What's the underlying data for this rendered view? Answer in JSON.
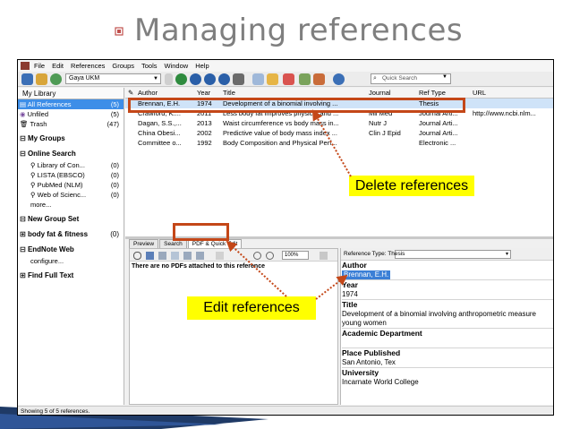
{
  "slide": {
    "title": "Managing references"
  },
  "menu": {
    "items": [
      "File",
      "Edit",
      "References",
      "Groups",
      "Tools",
      "Window",
      "Help"
    ]
  },
  "toolbar": {
    "library": "Gaya UKM",
    "quick_search": "Quick Search"
  },
  "sidebar": {
    "header": "My Library",
    "library_items": [
      {
        "label": "All References",
        "count": "(5)"
      },
      {
        "label": "Unfiled",
        "count": "(5)"
      },
      {
        "label": "Trash",
        "count": "(47)"
      }
    ],
    "my_groups": "My Groups",
    "online_search": "Online Search",
    "online_items": [
      {
        "label": "Library of Con...",
        "count": "(0)"
      },
      {
        "label": "LISTA (EBSCO)",
        "count": "(0)"
      },
      {
        "label": "PubMed (NLM)",
        "count": "(0)"
      },
      {
        "label": "Web of Scienc...",
        "count": "(0)"
      }
    ],
    "more": "more...",
    "new_group_set": "New Group Set",
    "group_set": {
      "label": "body fat & fitness",
      "count": "(0)"
    },
    "endnote_web": "EndNote Web",
    "configure": "configure...",
    "find_full_text": "Find Full Text"
  },
  "reflist": {
    "columns": {
      "author": "Author",
      "year": "Year",
      "title": "Title",
      "journal": "Journal",
      "ref_type": "Ref Type",
      "url": "URL"
    },
    "rows": [
      {
        "author": "Brennan, E.H.",
        "year": "1974",
        "title": "Development of a binomial involving ...",
        "journal": "",
        "ref_type": "Thesis",
        "url": ""
      },
      {
        "author": "Crawford, K....",
        "year": "2011",
        "title": "Less body fat improves physical and ...",
        "journal": "Mil Med",
        "ref_type": "Journal Arti...",
        "url": "http://www.ncbi.nlm..."
      },
      {
        "author": "Dagan, S.S.,...",
        "year": "2013",
        "title": "Waist circumference vs body mass in...",
        "journal": "Nutr J",
        "ref_type": "Journal Arti...",
        "url": ""
      },
      {
        "author": "China Obesi...",
        "year": "2002",
        "title": "Predictive value of body mass index ...",
        "journal": "Clin J Epid",
        "ref_type": "Journal Arti...",
        "url": ""
      },
      {
        "author": "Committee o...",
        "year": "1992",
        "title": "Body Composition and Physical Perf...",
        "journal": "",
        "ref_type": "Electronic ...",
        "url": ""
      }
    ]
  },
  "tabs": [
    "Preview",
    "Search",
    "PDF & Quick Edit"
  ],
  "pdf": {
    "zoom": "100%",
    "message": "There are no PDFs attached to this reference"
  },
  "ref_editor": {
    "ref_type_label": "Reference Type: Thesis",
    "author_label": "Author",
    "author_value": "Brennan, E.H.",
    "year_label": "Year",
    "year_value": "1974",
    "title_label": "Title",
    "title_value_1": "Development of a binomial involving anthropometric measure",
    "title_value_2": "young women",
    "academic_dept_label": "Academic Department",
    "place_label": "Place Published",
    "place_value": "San Antonio, Tex",
    "university_label": "University",
    "university_value": "Incarnate World College"
  },
  "status": "Showing 5 of 5 references.",
  "annotations": {
    "delete": "Delete references",
    "edit": "Edit references"
  },
  "colors": {
    "accent_orange": "#c44718",
    "callout_yellow": "#ffff00",
    "selection_blue": "#3d8ee8",
    "title_gray": "#7f7f7f"
  }
}
